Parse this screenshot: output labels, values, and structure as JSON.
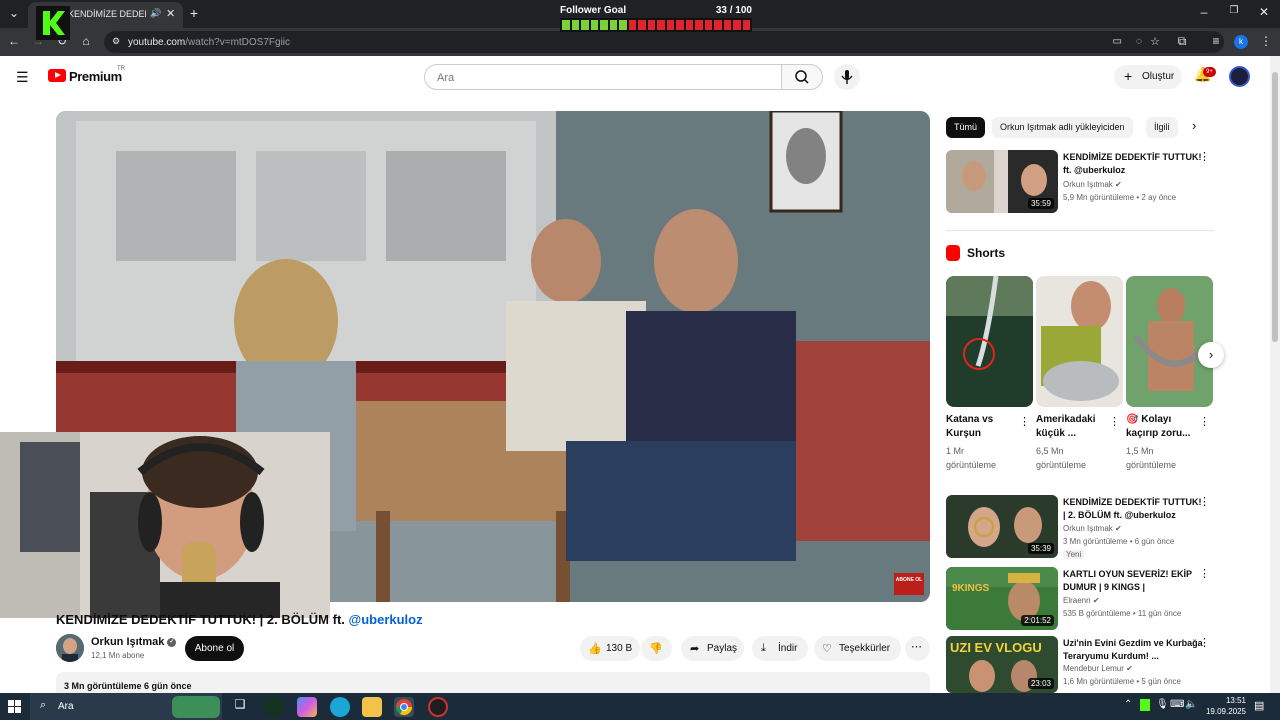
{
  "browser": {
    "tab_title": "KENDİMİZE DEDEKTİF T",
    "url_domain": "youtube.com",
    "url_path": "/watch?v=mtDOS7Fgiic"
  },
  "overlay": {
    "goal_label": "Follower Goal",
    "goal_count": "33 / 100",
    "goal_progress": 0.33,
    "logo_letter": "K"
  },
  "header": {
    "brand": "Premium",
    "region": "TR",
    "search_placeholder": "Ara",
    "create_label": "Oluştur",
    "notif_badge": "9+"
  },
  "video": {
    "title": "KENDİMİZE DEDEKTİF TUTTUK! | 2. BÖLÜM ft.",
    "mention": "@uberkuloz",
    "channel": "Orkun Işıtmak",
    "subscribers": "12,1 Mn abone",
    "subscribe_label": "Abone ol",
    "likes": "130 B",
    "share_label": "Paylaş",
    "download_label": "İndir",
    "thanks_label": "Teşekkürler",
    "stats": "3 Mn görüntüleme  6 gün önce",
    "sub_watermark": "ABONE OL"
  },
  "sidebar": {
    "chips": [
      "Tümü",
      "Orkun Işıtmak adlı yükleyiciden",
      "İlgili"
    ],
    "shorts_heading": "Shorts",
    "related": [
      {
        "title": "KENDİMİZE DEDEKTİF TUTTUK! ft. @uberkuloz",
        "channel": "Orkun Işıtmak",
        "meta": "5,9 Mn görüntüleme • 2 ay önce",
        "duration": "35:59",
        "badge": ""
      },
      {
        "title": "KENDİMİZE DEDEKTİF TUTTUK! | 2. BÖLÜM ft. @uberkuloz",
        "channel": "Orkun Işıtmak",
        "meta": "3 Mn görüntüleme • 6 gün önce",
        "duration": "35:39",
        "badge": "Yeni"
      },
      {
        "title": "KARTLI OYUN SEVERİZ! EKİP DUMUR | 9 KINGS |",
        "channel": "Elraenn",
        "meta": "535 B görüntüleme • 11 gün önce",
        "duration": "2:01:52",
        "badge": ""
      },
      {
        "title": "Uzi'nin Evini Gezdim ve Kurbağa Teraryumu Kurdum! ...",
        "channel": "Mendebur Lemur",
        "meta": "1,6 Mn görüntüleme • 5 gün önce",
        "duration": "23:03",
        "badge": ""
      }
    ],
    "shorts": [
      {
        "title": "Katana vs Kurşun",
        "views": "1 Mr görüntüleme"
      },
      {
        "title": "Amerikadaki küçük ...",
        "views": "6,5 Mn görüntüleme"
      },
      {
        "title": "🎯 Kolayı kaçırıp zoru...",
        "views": "1,5 Mn görüntüleme"
      }
    ]
  },
  "taskbar": {
    "search_label": "Ara",
    "time": "13:51",
    "date": "19.09.2025"
  },
  "colors": {
    "yt_red": "#ff0000",
    "goal_filled": "#7bd13a",
    "goal_empty": "#e0232e",
    "link_blue": "#065fd4"
  }
}
